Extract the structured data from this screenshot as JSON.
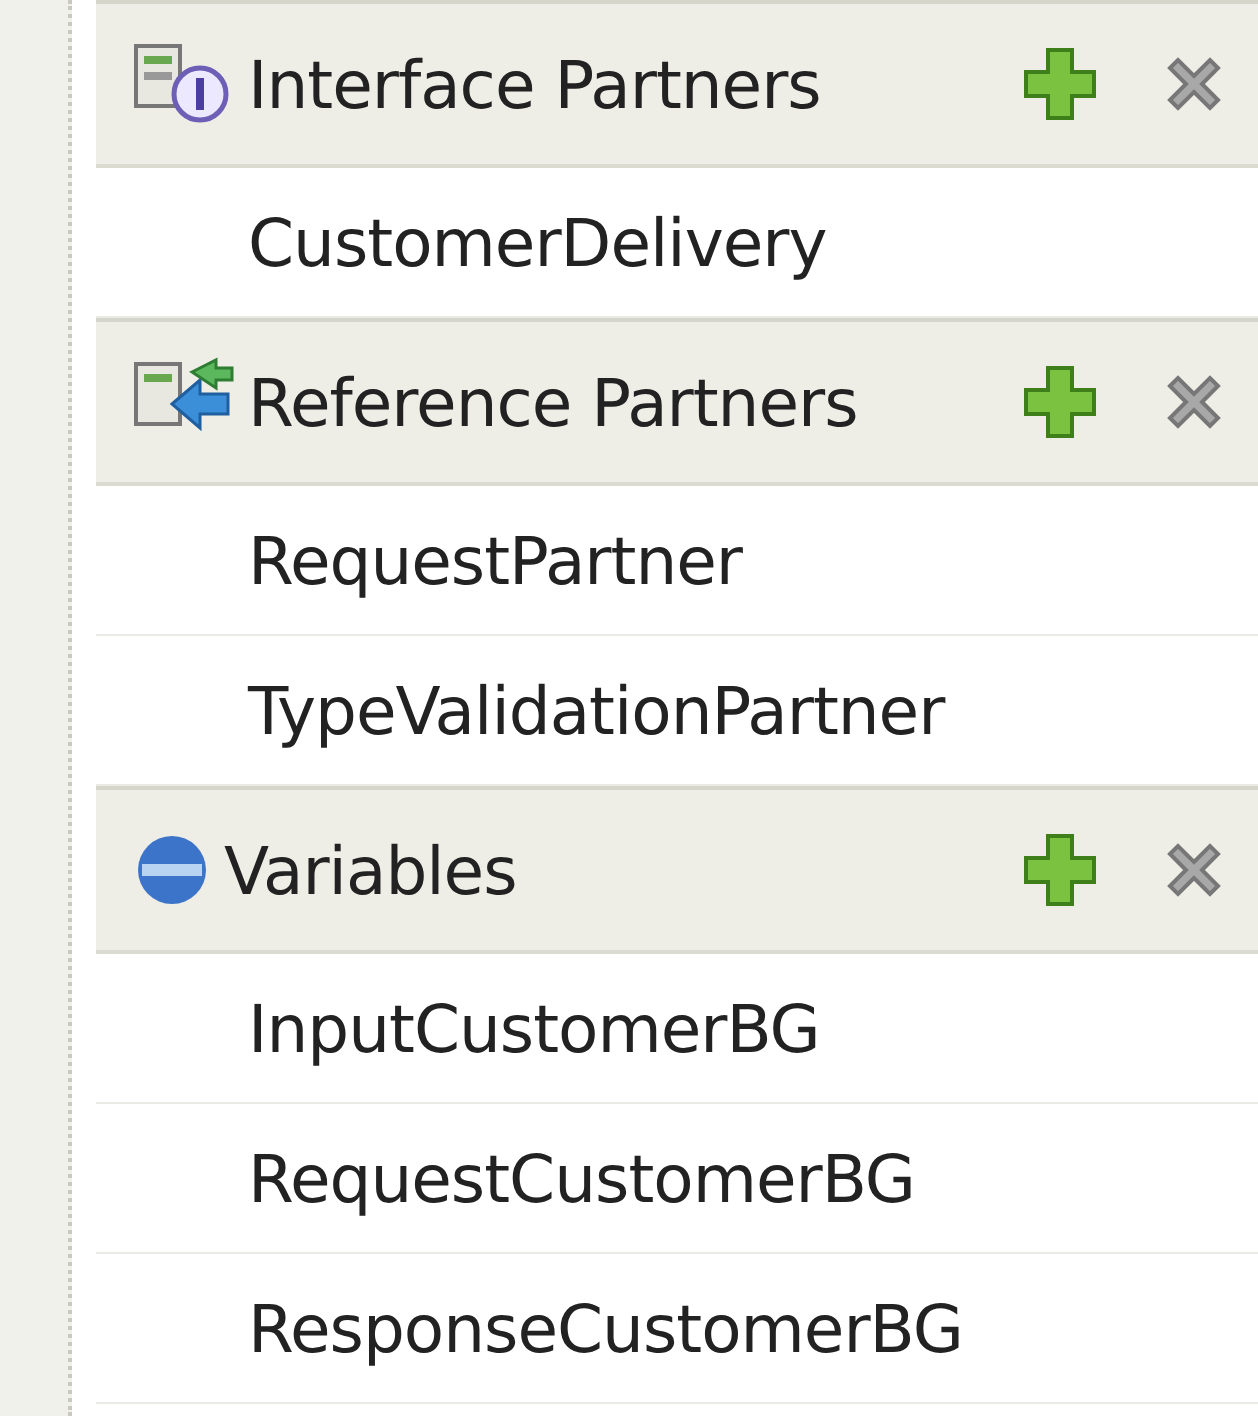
{
  "sections": [
    {
      "title": "Interface Partners",
      "kind": "interface",
      "items": [
        "CustomerDelivery"
      ]
    },
    {
      "title": "Reference Partners",
      "kind": "reference",
      "items": [
        "RequestPartner",
        "TypeValidationPartner"
      ]
    },
    {
      "title": "Variables",
      "kind": "variables",
      "items": [
        "InputCustomerBG",
        "RequestCustomerBG",
        "ResponseCustomerBG"
      ]
    }
  ]
}
